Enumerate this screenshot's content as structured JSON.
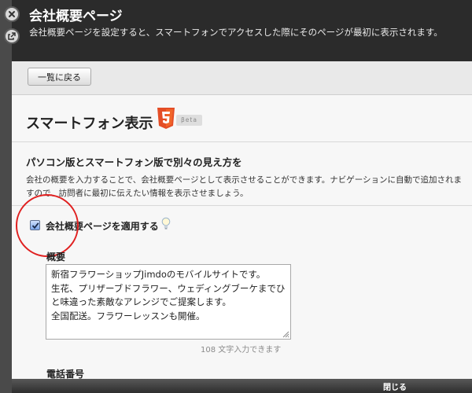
{
  "header": {
    "title": "会社概要ページ",
    "description": "会社概要ページを設定すると、スマートフォンでアクセスした際にそのページが最初に表示されます。"
  },
  "toolbar": {
    "back_label": "一覧に戻る"
  },
  "section": {
    "title": "スマートフォン表示",
    "badge": "βeta"
  },
  "subheading": "パソコン版とスマートフォン版で別々の見え方を",
  "description": "会社の概要を入力することで、会社概要ページとして表示させることができます。ナビゲーションに自動で追加されますので、訪問者に最初に伝えたい情報を表示させましょう。",
  "apply_checkbox": {
    "label": "会社概要ページを適用する",
    "checked": true
  },
  "summary": {
    "label": "概要",
    "value": "新宿フラワーショップJimdoのモバイルサイトです。\n生花、プリザーブドフラワー、ウェディングブーケまでひと味違った素敵なアレンジでご提案します。\n全国配送。フラワーレッスンも開催。",
    "counter": "108 文字入力できます"
  },
  "phone": {
    "label": "電話番号"
  },
  "footer": {
    "close_label": "閉じる"
  },
  "icons": {
    "close": "close-icon",
    "popout": "popout-icon",
    "html5": "html5-icon",
    "hint": "lightbulb-icon"
  },
  "colors": {
    "header_bg": "#2b2b2b",
    "html5_orange": "#e44d26",
    "highlight_circle": "#e02020"
  }
}
